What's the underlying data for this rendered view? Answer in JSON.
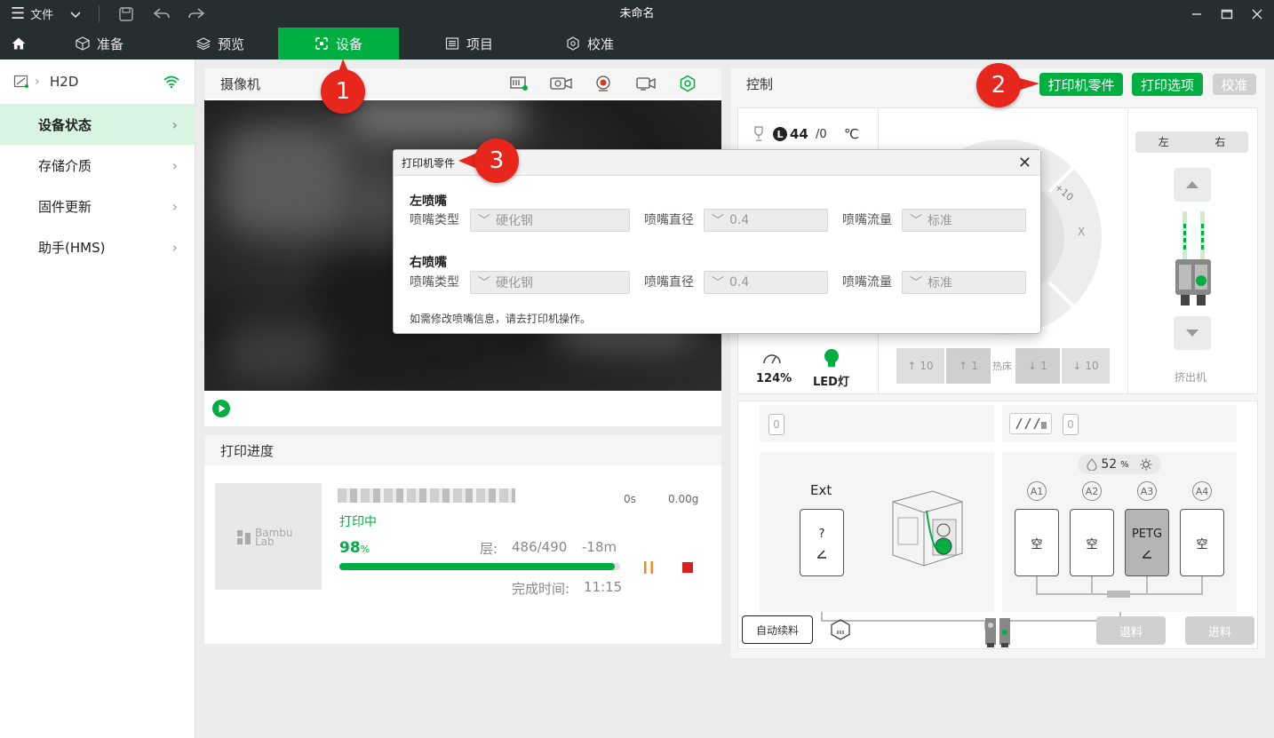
{
  "titlebar": {
    "menu_label": "文件",
    "title": "未命名"
  },
  "nav": {
    "tabs": [
      {
        "label": "准备"
      },
      {
        "label": "预览"
      },
      {
        "label": "设备"
      },
      {
        "label": "项目"
      },
      {
        "label": "校准"
      }
    ],
    "active_tab": "设备"
  },
  "sidebar": {
    "device_name": "H2D",
    "items": [
      {
        "label": "设备状态"
      },
      {
        "label": "存储介质"
      },
      {
        "label": "固件更新"
      },
      {
        "label": "助手(HMS)"
      }
    ]
  },
  "camera": {
    "title": "摄像机"
  },
  "progress": {
    "title": "打印进度",
    "logo_text_1": "Bambu",
    "logo_text_2": "Lab",
    "status": "打印中",
    "percent": "98",
    "percent_unit": "%",
    "percent_value": 0.98,
    "layer_label": "层:",
    "layer_value": "486/490",
    "remaining": "-18m",
    "time": "0s",
    "weight": "0.00g",
    "finish_label": "完成时间:",
    "finish_value": "11:15"
  },
  "control": {
    "title": "控制",
    "btn_parts": "打印机零件",
    "btn_options": "打印选项",
    "btn_calibrate": "校准",
    "nozzle_badge": "L",
    "nozzle_temp": "44",
    "nozzle_target": "/0",
    "temp_unit": "℃",
    "axis_step": "+10",
    "axis_x": "X",
    "speed": "124%",
    "led_label": "LED灯",
    "bed_up10": "10",
    "bed_up1": "1",
    "bed_label": "热床",
    "bed_down1": "1",
    "bed_down10": "10",
    "toggle_left": "左",
    "toggle_right": "右",
    "extruder_label": "挤出机"
  },
  "ams": {
    "slot_zero_left": "0",
    "slot_zero_right": "0",
    "ext_label": "Ext",
    "ext_slot_text": "?",
    "humidity": "52",
    "humidity_unit": "%",
    "slots": [
      {
        "id": "A1",
        "text": "空"
      },
      {
        "id": "A2",
        "text": "空"
      },
      {
        "id": "A3",
        "text": "PETG"
      },
      {
        "id": "A4",
        "text": "空"
      }
    ],
    "auto_refill": "自动续料",
    "unload": "退料",
    "load": "进料"
  },
  "dialog": {
    "title": "打印机零件",
    "left_title": "左喷嘴",
    "right_title": "右喷嘴",
    "type_label": "喷嘴类型",
    "diameter_label": "喷嘴直径",
    "flow_label": "喷嘴流量",
    "left": {
      "type": "硬化钢",
      "diameter": "0.4",
      "flow": "标准"
    },
    "right": {
      "type": "硬化钢",
      "diameter": "0.4",
      "flow": "标准"
    },
    "note": "如需修改喷嘴信息，请去打印机操作。"
  },
  "badges": {
    "one": "1",
    "two": "2",
    "three": "3"
  },
  "colors": {
    "accent": "#00ae42",
    "badge": "#e8271c",
    "pause": "#f08a24",
    "stop": "#d42020"
  }
}
